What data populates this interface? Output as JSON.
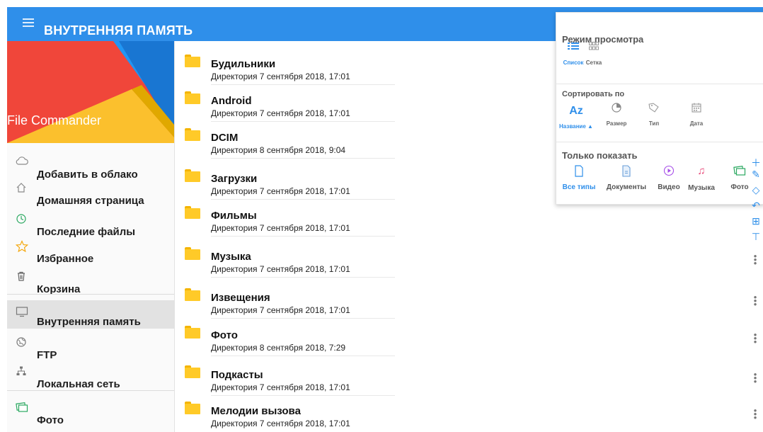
{
  "header": {
    "title": "ВНУТРЕННЯЯ ПАМЯТЬ",
    "menu_icon": "hamburger-icon"
  },
  "sidebar": {
    "brand": "File Commander",
    "items": [
      {
        "label": "Добавить в облако",
        "icon": "cloud-icon"
      },
      {
        "label": "Домашняя страница",
        "icon": "home-icon"
      },
      {
        "label": "Последние файлы",
        "icon": "clock-icon"
      },
      {
        "label": "Избранное",
        "icon": "star-icon"
      },
      {
        "label": "Корзина",
        "icon": "trash-icon"
      },
      {
        "label": "Внутренняя память",
        "icon": "monitor-icon"
      },
      {
        "label": "FTP",
        "icon": "globe-icon"
      },
      {
        "label": "Локальная сеть",
        "icon": "network-icon"
      },
      {
        "label": "Фото",
        "icon": "photo-icon"
      }
    ],
    "selected_item": "Внутренняя память"
  },
  "files": [
    {
      "name": "Будильники",
      "meta": "Директория 7 сентября 2018, 17:01"
    },
    {
      "name": "Android",
      "meta": "Директория 7 сентября 2018, 17:01"
    },
    {
      "name": "DCIM",
      "meta": "Директория 8 сентября 2018, 9:04"
    },
    {
      "name": "Загрузки",
      "meta": "Директория 7 сентября 2018, 17:01"
    },
    {
      "name": "Фильмы",
      "meta": "Директория 7 сентября 2018, 17:01"
    },
    {
      "name": "Музыка",
      "meta": "Директория 7 сентября 2018, 17:01"
    },
    {
      "name": "Извещения",
      "meta": "Директория 7 сентября 2018, 17:01"
    },
    {
      "name": "Фото",
      "meta": "Директория 8 сентября 2018, 7:29"
    },
    {
      "name": "Подкасты",
      "meta": "Директория 7 сентября 2018, 17:01"
    },
    {
      "name": "Мелодии вызова",
      "meta": "Директория 7 сентября 2018, 17:01"
    }
  ],
  "view_panel": {
    "mode_title": "Режим просмотра",
    "modes": [
      {
        "label": "Список",
        "icon": "list-icon",
        "active": true
      },
      {
        "label": "Сетка",
        "icon": "grid-icon",
        "active": false
      }
    ],
    "sort_title": "Сортировать по",
    "sorts": [
      {
        "label": "Название",
        "icon": "az-icon",
        "active": true,
        "ascending": true
      },
      {
        "label": "Размер",
        "icon": "pie-icon",
        "active": false
      },
      {
        "label": "Тип",
        "icon": "tag-icon",
        "active": false
      },
      {
        "label": "Дата",
        "icon": "calendar-icon",
        "active": false
      }
    ],
    "filter_title": "Только показать",
    "filters": [
      {
        "label": "Все типы",
        "icon": "file-icon",
        "active": true
      },
      {
        "label": "Документы",
        "icon": "document-icon",
        "active": false
      },
      {
        "label": "Видео",
        "icon": "video-icon",
        "active": false
      },
      {
        "label": "Музыка",
        "icon": "music-icon",
        "active": false
      },
      {
        "label": "Фото",
        "icon": "photo-icon",
        "active": false
      }
    ]
  },
  "colors": {
    "accent": "#2f8fea",
    "banner_red": "#f0463a",
    "banner_yellow": "#fbc02d",
    "banner_blue": "#2196f3",
    "folder": "#ffca28"
  }
}
